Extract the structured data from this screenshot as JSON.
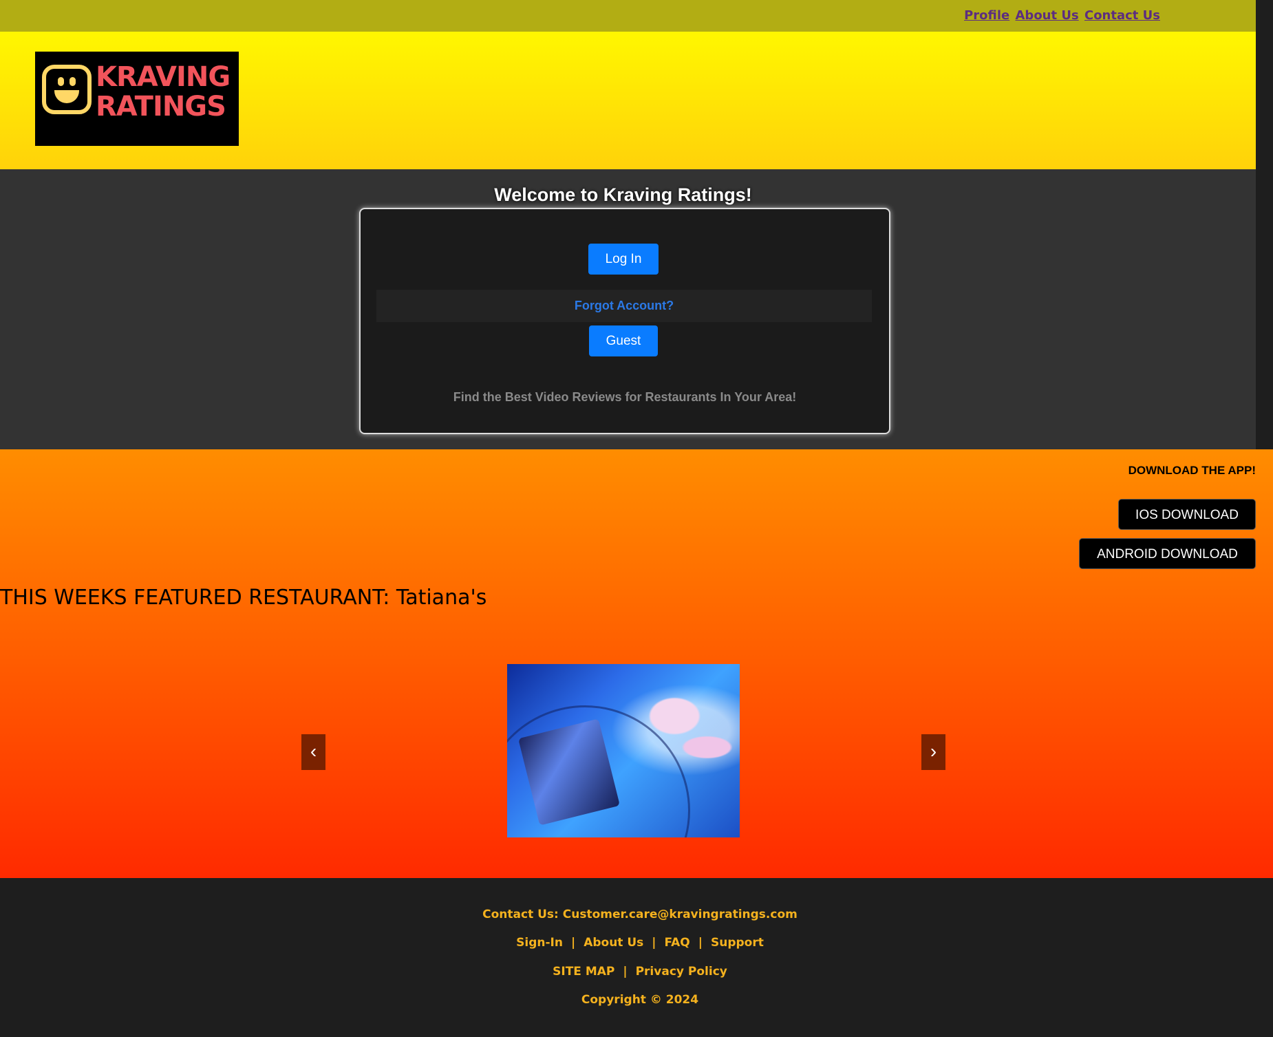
{
  "topbar": {
    "links": [
      "Profile",
      "About Us",
      "Contact Us"
    ],
    "link_color": "#5c2d80",
    "background": "#b2ad14"
  },
  "logo": {
    "line1": "KRAVING",
    "line2": "RATINGS",
    "icon": "smiley-face-icon"
  },
  "hero": {
    "title": "Welcome to Kraving Ratings!",
    "login_label": "Log In",
    "forgot_label": "Forgot Account?",
    "guest_label": "Guest",
    "tagline": "Find the Best Video Reviews for Restaurants In Your Area!",
    "accent": "#0a7cff"
  },
  "promo": {
    "download_heading": "DOWNLOAD THE APP!",
    "ios_label": "IOS DOWNLOAD",
    "android_label": "ANDROID DOWNLOAD",
    "featured_text": "THIS WEEKS FEATURED RESTAURANT: Tatiana's",
    "prev_arrow": "‹",
    "next_arrow": "›"
  },
  "footer": {
    "contact": "Contact Us: Customer.care@kravingratings.com",
    "nav1": [
      "Sign-In",
      "About Us",
      "FAQ",
      "Support"
    ],
    "nav2": [
      "SITE MAP",
      "Privacy Policy"
    ],
    "separator": "|",
    "copyright": "Copyright © 2024",
    "text_color": "#f5b21e"
  }
}
